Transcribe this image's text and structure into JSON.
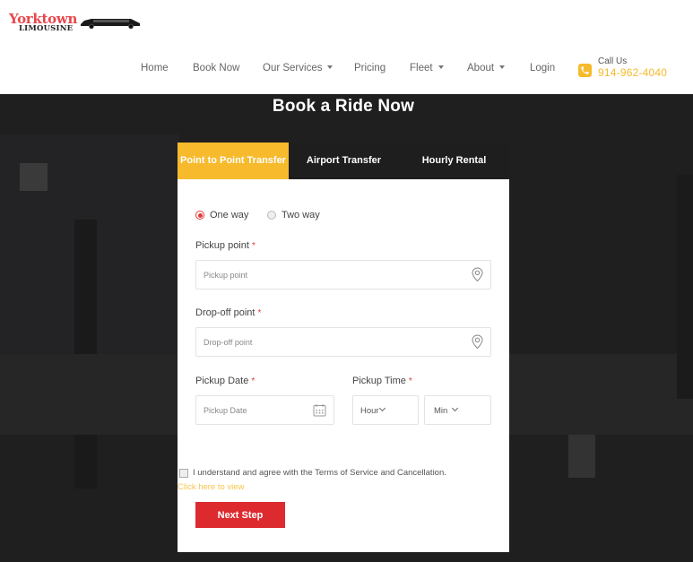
{
  "brand": {
    "name_main": "Yorktown",
    "name_sub": "LIMOUSINE",
    "logo_icon": "limousine-car-icon",
    "accent_color": "#f6ba2c",
    "brand_red": "#e8474c"
  },
  "nav": {
    "items": [
      {
        "label": "Home",
        "has_dropdown": false
      },
      {
        "label": "Book Now",
        "has_dropdown": false
      },
      {
        "label": "Our Services",
        "has_dropdown": true
      },
      {
        "label": "Pricing",
        "has_dropdown": false
      },
      {
        "label": "Fleet",
        "has_dropdown": true
      },
      {
        "label": "About",
        "has_dropdown": true
      },
      {
        "label": "Login",
        "has_dropdown": false
      }
    ],
    "call": {
      "icon": "phone-icon",
      "label": "Call Us",
      "number": "914-962-4040"
    }
  },
  "hero": {
    "title": "Book a Ride Now"
  },
  "booking": {
    "tabs": [
      {
        "label": "Point to Point Transfer",
        "active": true
      },
      {
        "label": "Airport Transfer",
        "active": false
      },
      {
        "label": "Hourly Rental",
        "active": false
      }
    ],
    "trip_type": {
      "options": [
        {
          "label": "One way",
          "checked": true
        },
        {
          "label": "Two way",
          "checked": false
        }
      ]
    },
    "pickup_point": {
      "label": "Pickup point",
      "required_mark": "*",
      "placeholder": "Pickup point",
      "value": "",
      "icon": "map-pin-icon"
    },
    "dropoff_point": {
      "label": "Drop-off point",
      "required_mark": "*",
      "placeholder": "Drop-off point",
      "value": "",
      "icon": "map-pin-icon"
    },
    "pickup_date": {
      "label": "Pickup Date",
      "required_mark": "*",
      "placeholder": "Pickup Date",
      "value": "",
      "icon": "calendar-icon"
    },
    "pickup_time": {
      "label": "Pickup Time",
      "required_mark": "*",
      "hour": {
        "selected": "Hour"
      },
      "minute": {
        "selected": "Min"
      }
    },
    "terms": {
      "checked": false,
      "text": "I understand and agree with the Terms of Service and Cancellation.",
      "link_text": "Click here to view"
    },
    "next_button": "Next Step"
  }
}
